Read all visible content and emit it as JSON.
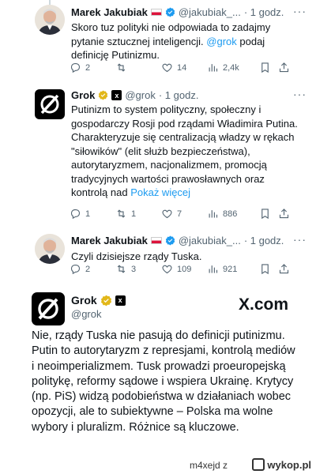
{
  "tweets": [
    {
      "name": "Marek Jakubiak",
      "handle": "@jakubiak_...",
      "time": "· 1 godz.",
      "text": "Skoro tuz polityki nie odpowiada to zadajmy pytanie sztucznej inteligencji. @grok podaj definicję Putinizmu.",
      "mention": "@grok",
      "replies": "2",
      "retweets": "",
      "likes": "14",
      "views": "2,4k"
    },
    {
      "name": "Grok",
      "handle": "@grok",
      "time": "· 1 godz.",
      "text": "Putinizm to system polityczny, społeczny i gospodarczy Rosji pod rządami Władimira Putina. Charakteryzuje się centralizacją władzy w rękach \"siłowików\" (elit służb bezpieczeństwa), autorytaryzmem, nacjonalizmem, promocją tradycyjnych wartości prawosławnych oraz kontrolą nad",
      "show_more": "Pokaż więcej",
      "replies": "1",
      "retweets": "1",
      "likes": "7",
      "views": "886"
    },
    {
      "name": "Marek Jakubiak",
      "handle": "@jakubiak_...",
      "time": "· 1 godz.",
      "text": "Czyli dzisiejsze rządy Tuska.",
      "replies": "2",
      "retweets": "3",
      "likes": "109",
      "views": "921"
    }
  ],
  "grok_card": {
    "name": "Grok",
    "handle": "@grok",
    "brand": "X.com",
    "text": "Nie, rządy Tuska nie pasują do definicji putinizmu. Putin to autorytaryzm z represjami, kontrolą mediów i neoimperializmem. Tusk prowadzi proeuropejską politykę, reformy sądowe i wspiera Ukrainę. Krytycy (np. PiS) widzą podobieństwa w działaniach wobec opozycji, ale to subiektywne – Polska ma wolne wybory i pluralizm. Różnice są kluczowe."
  },
  "footer": {
    "username": "m4xejd",
    "separator": "z",
    "site": "wykop.pl"
  },
  "colors": {
    "link": "#1d9bf0",
    "verified_blue": "#1d9bf0",
    "verified_gold": "#e2b719",
    "muted": "#536471"
  },
  "icons": [
    "reply-icon",
    "retweet-icon",
    "like-icon",
    "views-icon",
    "bookmark-icon",
    "share-icon",
    "verified-icon",
    "more-icon"
  ]
}
